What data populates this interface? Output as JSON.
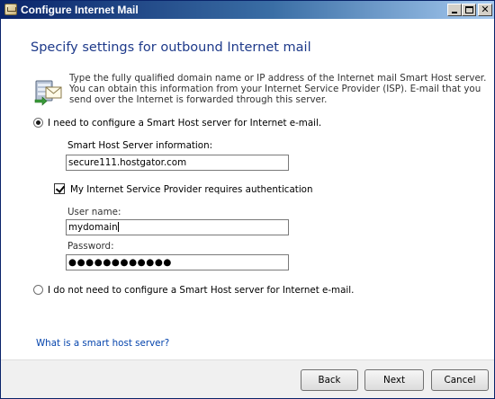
{
  "window": {
    "title": "Configure Internet Mail"
  },
  "page": {
    "heading": "Specify settings for outbound Internet mail",
    "description": "Type the fully qualified domain name or IP address of the Internet mail Smart Host server. You can obtain this information from your Internet Service Provider (ISP). E-mail that you send over the Internet is forwarded through this server.",
    "icon": "mail-server-icon"
  },
  "options": {
    "configure_label": "I need to configure a Smart Host server for Internet e-mail.",
    "configure_selected": true,
    "no_configure_label": "I do not need to configure a Smart Host server for Internet e-mail."
  },
  "smart_host": {
    "label": "Smart Host Server information:",
    "value": "secure111.hostgator.com"
  },
  "auth": {
    "label": "My Internet Service Provider requires authentication",
    "checked": true,
    "username_label": "User name:",
    "username_value": "mydomain",
    "password_label": "Password:",
    "password_value": "●●●●●●●●●●●●"
  },
  "links": {
    "help": "What is a smart host server?"
  },
  "buttons": {
    "back": "Back",
    "next": "Next",
    "cancel": "Cancel"
  },
  "colors": {
    "heading": "#1e3a8a",
    "link": "#0645ad",
    "titlebar": "#0a246a"
  }
}
